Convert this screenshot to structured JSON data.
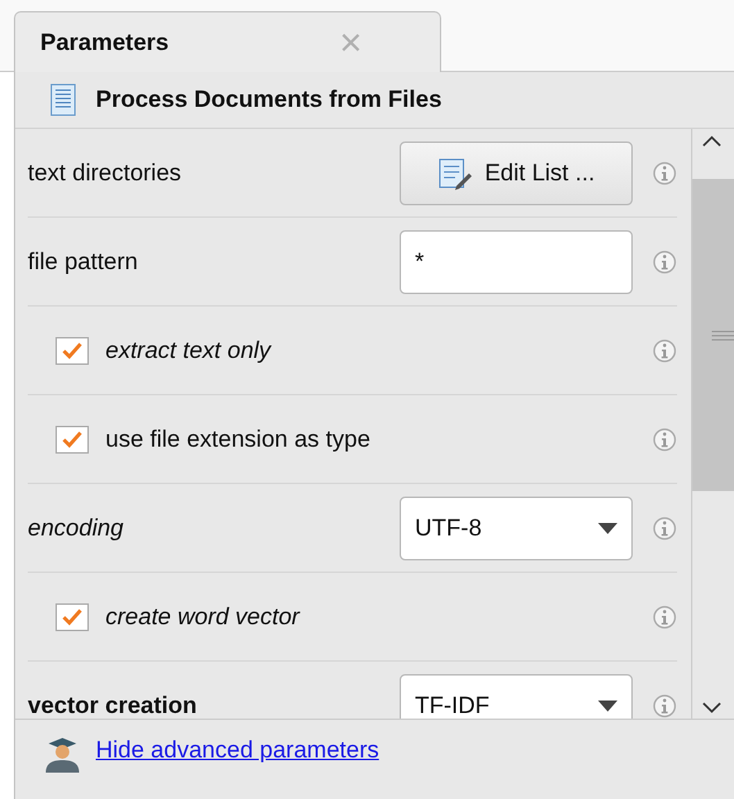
{
  "tabs": [
    {
      "label": "Parameters",
      "close": "×",
      "selected": true
    }
  ],
  "operator": {
    "title": "Process Documents from Files"
  },
  "parameters": [
    {
      "kind": "button",
      "label": "text directories",
      "expert": false,
      "primary": false,
      "value": "Edit List ..."
    },
    {
      "kind": "text",
      "label": "file pattern",
      "expert": false,
      "primary": false,
      "value": "*"
    },
    {
      "kind": "checkbox",
      "label": "extract text only",
      "expert": true,
      "primary": false,
      "checked": true
    },
    {
      "kind": "checkbox",
      "label": "use file extension as type",
      "expert": false,
      "primary": false,
      "checked": true
    },
    {
      "kind": "select",
      "label": "encoding",
      "expert": true,
      "primary": false,
      "value": "UTF-8"
    },
    {
      "kind": "checkbox",
      "label": "create word vector",
      "expert": true,
      "primary": false,
      "checked": true
    },
    {
      "kind": "select",
      "label": "vector creation",
      "expert": false,
      "primary": true,
      "value": "TF-IDF"
    }
  ],
  "footer": {
    "link": "Hide advanced parameters"
  }
}
